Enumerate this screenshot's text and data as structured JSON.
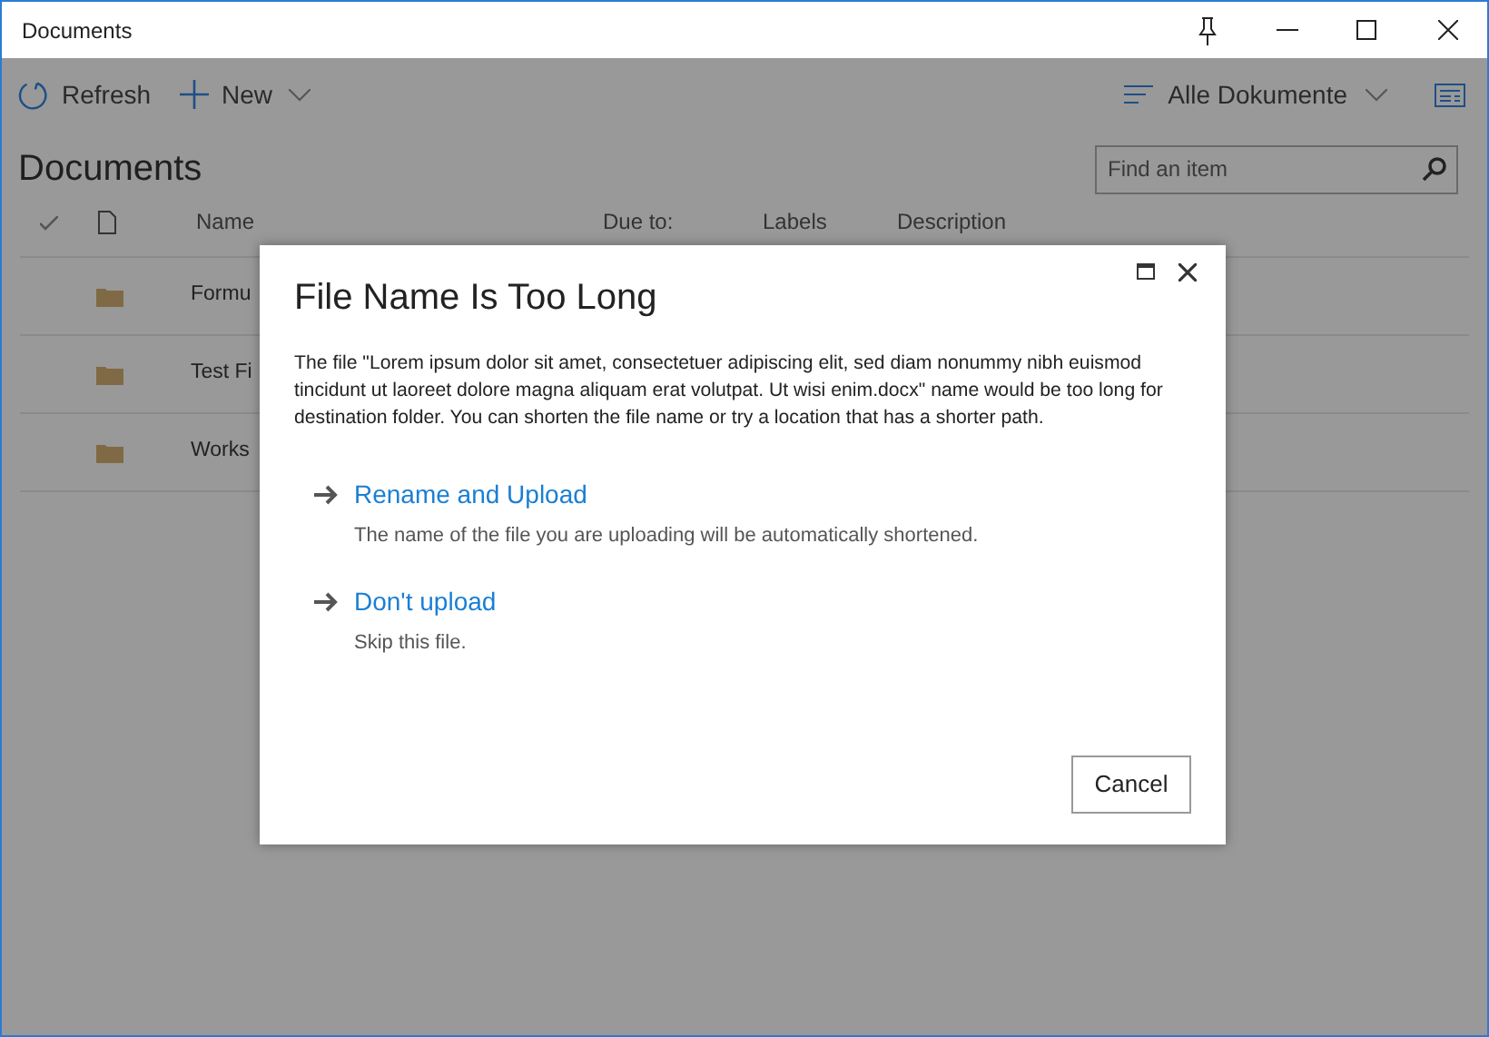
{
  "window": {
    "title": "Documents"
  },
  "toolbar": {
    "refresh": "Refresh",
    "new": "New",
    "view": "Alle Dokumente"
  },
  "page_title": "Documents",
  "search": {
    "placeholder": "Find an item"
  },
  "table": {
    "columns": [
      "Name",
      "Due to:",
      "Labels",
      "Description"
    ],
    "rows": [
      {
        "name": "Formu"
      },
      {
        "name": "Test Fi"
      },
      {
        "name": "Works"
      }
    ]
  },
  "dialog": {
    "title": "File Name Is Too Long",
    "message": "The file \"Lorem ipsum dolor sit amet, consectetuer adipiscing elit, sed diam nonummy nibh euismod tincidunt ut laoreet dolore magna aliquam erat volutpat. Ut wisi enim.docx\" name would be too long for destination folder. You can shorten the file name or try a location that has a shorter path.",
    "options": [
      {
        "label": "Rename and Upload",
        "description": "The name of the file you are uploading will be automatically shortened."
      },
      {
        "label": "Don't upload",
        "description": "Skip this file."
      }
    ],
    "cancel": "Cancel"
  }
}
